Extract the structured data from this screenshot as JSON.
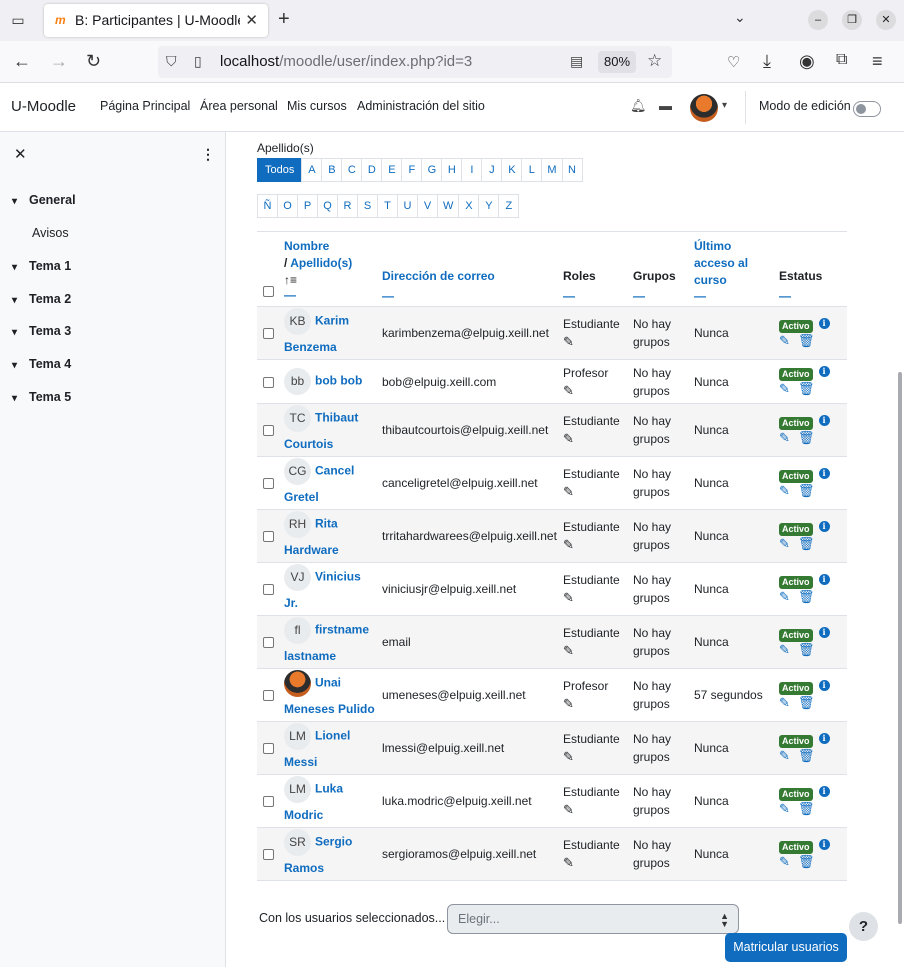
{
  "browser": {
    "tab_title": "B: Participantes | U-Moodle",
    "tab_favicon": "m",
    "url_host": "localhost",
    "url_path": "/moodle/user/index.php?id=3",
    "zoom": "80%"
  },
  "header": {
    "brand": "U-Moodle",
    "nav": [
      "Página Principal",
      "Área personal",
      "Mis cursos",
      "Administración del sitio"
    ],
    "edit_mode_label": "Modo de edición"
  },
  "drawer": {
    "sections": [
      {
        "label": "General",
        "items": [
          "Avisos"
        ]
      },
      {
        "label": "Tema 1"
      },
      {
        "label": "Tema 2"
      },
      {
        "label": "Tema 3"
      },
      {
        "label": "Tema 4"
      },
      {
        "label": "Tema 5"
      }
    ]
  },
  "filter": {
    "label": "Apellido(s)",
    "row1": [
      "Todos",
      "A",
      "B",
      "C",
      "D",
      "E",
      "F",
      "G",
      "H",
      "I",
      "J",
      "K",
      "L",
      "M",
      "N"
    ],
    "row2": [
      "Ñ",
      "O",
      "P",
      "Q",
      "R",
      "S",
      "T",
      "U",
      "V",
      "W",
      "X",
      "Y",
      "Z"
    ]
  },
  "table": {
    "headers": {
      "name": "Nombre",
      "surname": "Apellido(s)",
      "email": "Dirección de correo",
      "roles": "Roles",
      "groups": "Grupos",
      "access": "Último acceso al curso",
      "status": "Estatus",
      "dash": "—",
      "sort_icon": "↑≡"
    },
    "rows": [
      {
        "initials": "KB",
        "name1": "Karim",
        "name2": "Benzema",
        "email": "karimbenzema@elpuig.xeill.net",
        "role": "Estudiante",
        "groups": "No hay grupos",
        "access": "Nunca",
        "status": "Activo"
      },
      {
        "initials": "bb",
        "name1": "bob bob",
        "name2": "",
        "email": "bob@elpuig.xeill.com",
        "role": "Profesor",
        "groups": "No hay grupos",
        "access": "Nunca",
        "status": "Activo"
      },
      {
        "initials": "TC",
        "name1": "Thibaut",
        "name2": "Courtois",
        "email": "thibautcourtois@elpuig.xeill.net",
        "role": "Estudiante",
        "groups": "No hay grupos",
        "access": "Nunca",
        "status": "Activo"
      },
      {
        "initials": "CG",
        "name1": "Cancel",
        "name2": "Gretel",
        "email": "canceligretel@elpuig.xeill.net",
        "role": "Estudiante",
        "groups": "No hay grupos",
        "access": "Nunca",
        "status": "Activo"
      },
      {
        "initials": "RH",
        "name1": "Rita",
        "name2": "Hardware",
        "email": "trritahardwarees@elpuig.xeill.net",
        "role": "Estudiante",
        "groups": "No hay grupos",
        "access": "Nunca",
        "status": "Activo"
      },
      {
        "initials": "VJ",
        "name1": "Vinicius",
        "name2": "Jr.",
        "email": "viniciusjr@elpuig.xeill.net",
        "role": "Estudiante",
        "groups": "No hay grupos",
        "access": "Nunca",
        "status": "Activo"
      },
      {
        "initials": "fl",
        "name1": "firstname",
        "name2": "lastname",
        "email": "email",
        "role": "Estudiante",
        "groups": "No hay grupos",
        "access": "Nunca",
        "status": "Activo"
      },
      {
        "initials": "",
        "photo": true,
        "name1": "Unai",
        "name2": "Meneses Pulido",
        "email": "umeneses@elpuig.xeill.net",
        "role": "Profesor",
        "groups": "No hay grupos",
        "access": "57 segundos",
        "status": "Activo"
      },
      {
        "initials": "LM",
        "name1": "Lionel",
        "name2": "Messi",
        "email": "lmessi@elpuig.xeill.net",
        "role": "Estudiante",
        "groups": "No hay grupos",
        "access": "Nunca",
        "status": "Activo"
      },
      {
        "initials": "LM",
        "name1": "Luka",
        "name2": "Modric",
        "email": "luka.modric@elpuig.xeill.net",
        "role": "Estudiante",
        "groups": "No hay grupos",
        "access": "Nunca",
        "status": "Activo"
      },
      {
        "initials": "SR",
        "name1": "Sergio",
        "name2": "Ramos",
        "email": "sergioramos@elpuig.xeill.net",
        "role": "Estudiante",
        "groups": "No hay grupos",
        "access": "Nunca",
        "status": "Activo"
      }
    ]
  },
  "bulk": {
    "label": "Con los usuarios seleccionados...",
    "select_value": "Elegir..."
  },
  "buttons": {
    "enrol": "Matricular usuarios",
    "help": "?"
  },
  "colors": {
    "link": "#0f6cbf",
    "badge": "#357a32"
  }
}
